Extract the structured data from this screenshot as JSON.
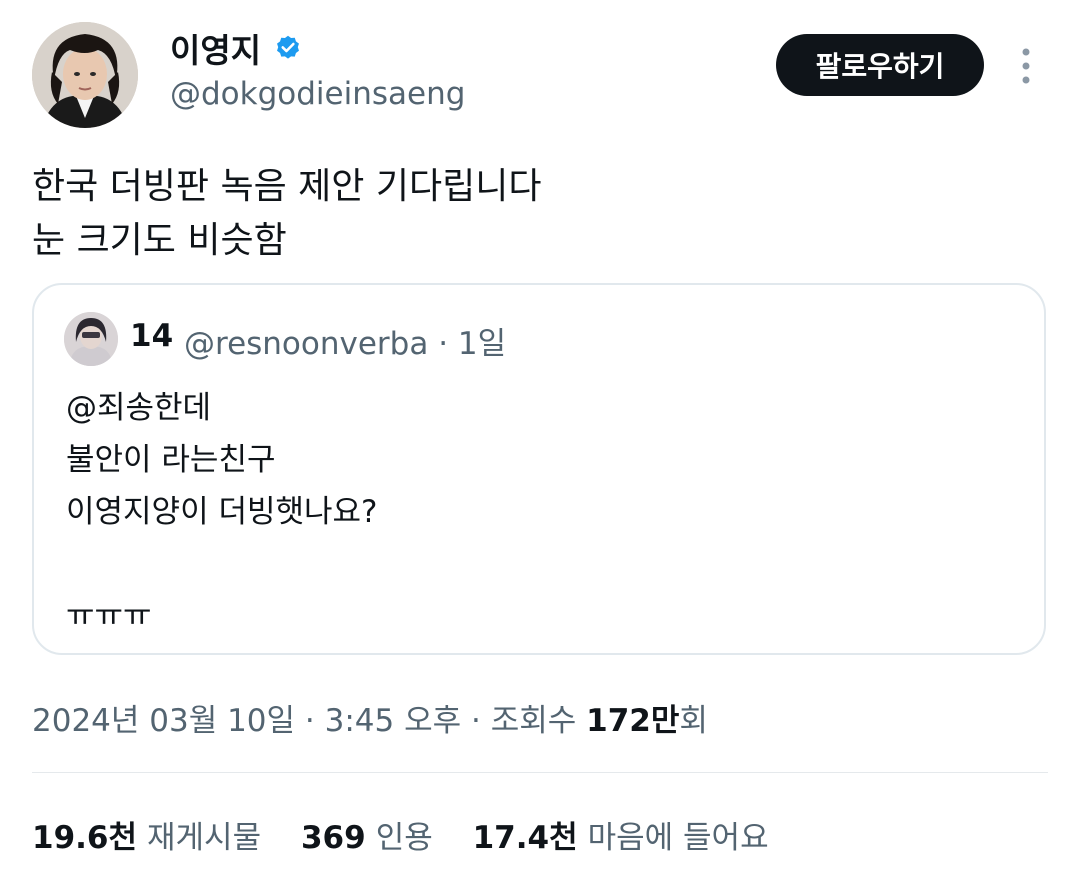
{
  "author": {
    "name": "이영지",
    "handle": "@dokgodieinsaeng",
    "verified_color": "#1d9bf0"
  },
  "follow_label": "팔로우하기",
  "more_icon": "more-vertical-icon",
  "tweet": {
    "lines": [
      "한국 더빙판 녹음 제안 기다립니다",
      "눈 크기도 비슷함"
    ]
  },
  "quote": {
    "name": "14",
    "handle": "@resnoonverba",
    "separator": " · ",
    "time": "1일",
    "lines": [
      "@죄송한데",
      "불안이 라는친구",
      "이영지양이 더빙햇나요?",
      "",
      "ㅠㅠㅠ"
    ]
  },
  "timestamp": {
    "date": "2024년 03월 10일",
    "sep1": " · ",
    "time": "3:45 오후",
    "sep2": " · ",
    "views_label": "조회수 ",
    "views_num": "172만",
    "views_suffix": "회"
  },
  "stats": {
    "retweets_num": "19.6천",
    "retweets_label": "재게시물",
    "quotes_num": "369",
    "quotes_label": "인용",
    "likes_num": "17.4천",
    "likes_label": "마음에 들어요"
  }
}
